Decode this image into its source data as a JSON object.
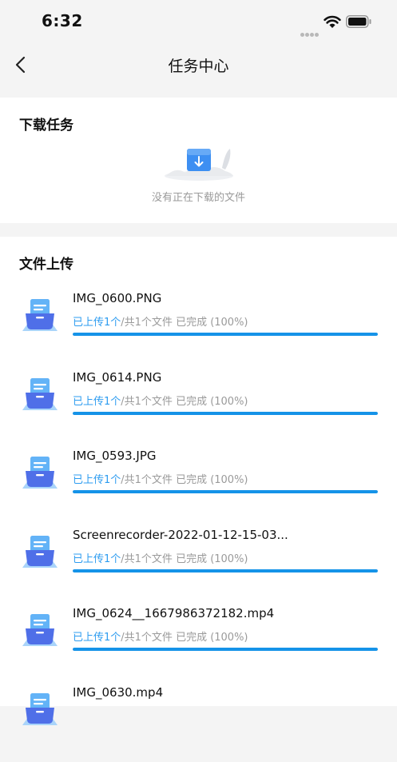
{
  "status_bar": {
    "time": "6:32"
  },
  "nav": {
    "title": "任务中心",
    "back_icon": "chevron-left-icon"
  },
  "download_section": {
    "title": "下载任务",
    "empty_text": "没有正在下载的文件",
    "illustration_icon": "download-box-icon"
  },
  "upload_section": {
    "title": "文件上传",
    "items": [
      {
        "name": "IMG_0600.PNG",
        "done": "已上传1个",
        "rest": "/共1个文件 已完成 (100%)",
        "progress": 1.0
      },
      {
        "name": "IMG_0614.PNG",
        "done": "已上传1个",
        "rest": "/共1个文件 已完成 (100%)",
        "progress": 1.0
      },
      {
        "name": "IMG_0593.JPG",
        "done": "已上传1个",
        "rest": "/共1个文件 已完成 (100%)",
        "progress": 1.0
      },
      {
        "name": "Screenrecorder-2022-01-12-15-03...",
        "done": "已上传1个",
        "rest": "/共1个文件 已完成 (100%)",
        "progress": 1.0
      },
      {
        "name": "IMG_0624__1667986372182.mp4",
        "done": "已上传1个",
        "rest": "/共1个文件 已完成 (100%)",
        "progress": 1.0
      },
      {
        "name": "IMG_0630.mp4",
        "done": "",
        "rest": "",
        "progress": null
      }
    ]
  },
  "colors": {
    "accent": "#1593e8",
    "accent_text": "#2d9cf0",
    "muted_text": "#9a9a9a",
    "page_bg": "#f4f4f4"
  }
}
